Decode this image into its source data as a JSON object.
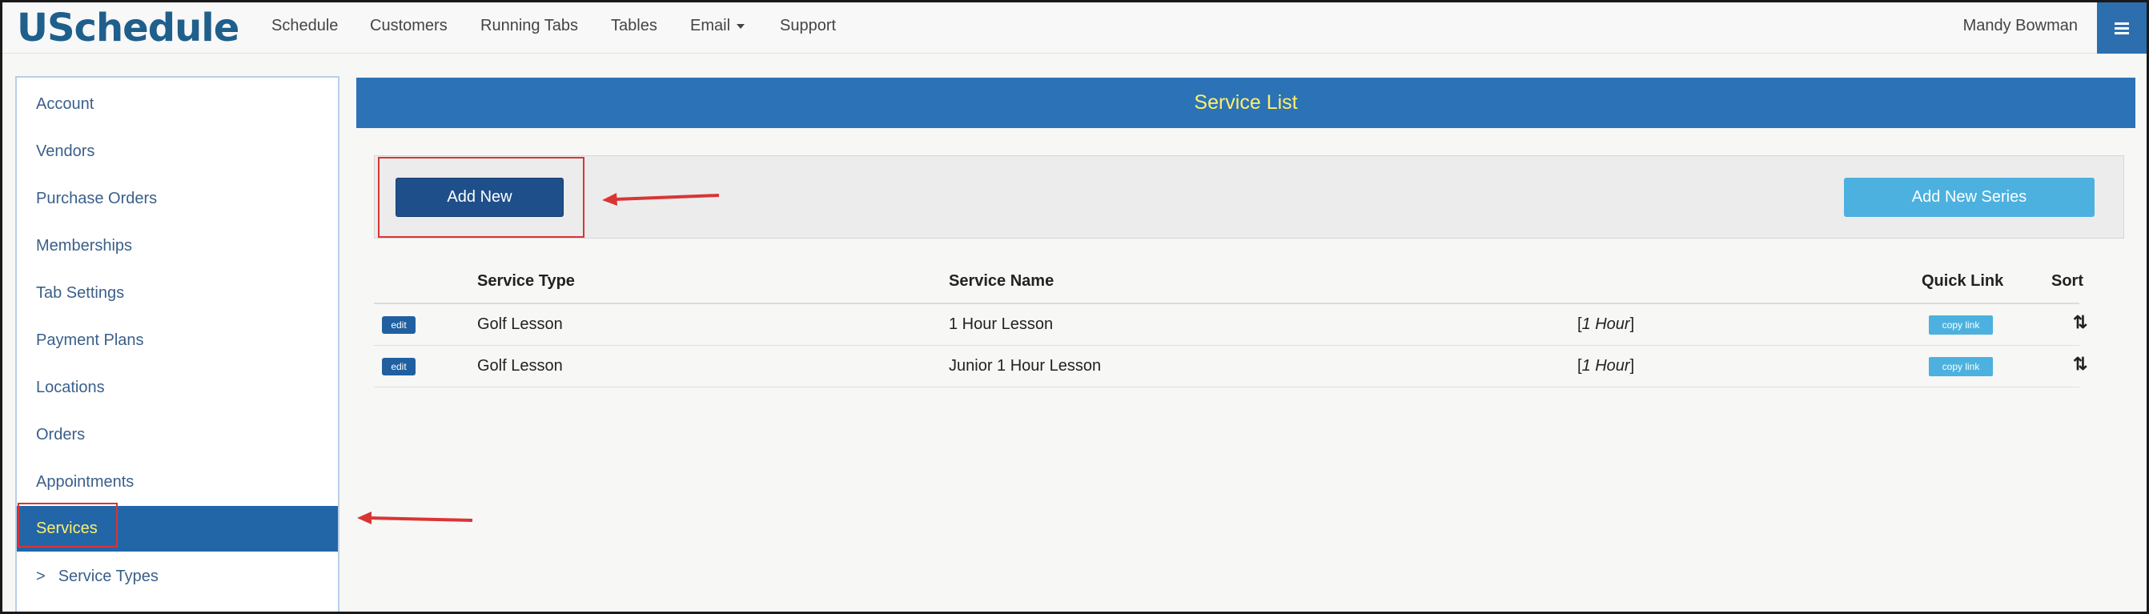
{
  "app": {
    "logo": "USchedule",
    "nav": [
      "Schedule",
      "Customers",
      "Running Tabs",
      "Tables",
      "Email",
      "Support"
    ],
    "user": "Mandy Bowman"
  },
  "sidebar": {
    "items": [
      {
        "label": "Account"
      },
      {
        "label": "Vendors"
      },
      {
        "label": "Purchase Orders"
      },
      {
        "label": "Memberships"
      },
      {
        "label": "Tab Settings"
      },
      {
        "label": "Payment Plans"
      },
      {
        "label": "Locations"
      },
      {
        "label": "Orders"
      },
      {
        "label": "Appointments"
      },
      {
        "label": "Services",
        "active": true
      }
    ],
    "sub_item": {
      "prefix": ">",
      "label": "Service Types"
    }
  },
  "main": {
    "title": "Service List",
    "add_new": "Add New",
    "add_new_series": "Add New Series",
    "table": {
      "headers": [
        "Service Type",
        "Service Name",
        "Quick Link",
        "Sort"
      ],
      "rows": [
        {
          "edit": "edit",
          "type": "Golf Lesson",
          "name": "1 Hour Lesson",
          "duration": "1 Hour",
          "link": "copy link"
        },
        {
          "edit": "edit",
          "type": "Golf Lesson",
          "name": "Junior 1 Hour Lesson",
          "duration": "1 Hour",
          "link": "copy link"
        }
      ]
    }
  },
  "icons": {
    "menu": "hamburger-menu-icon",
    "email_dropdown": "caret-down-icon",
    "sort": "sort-arrows-icon"
  },
  "colors": {
    "brand": "#1f5f8b",
    "header_bar": "#2c72b6",
    "active_text": "#ffef6b",
    "primary_button": "#1f4f8a",
    "info_button": "#4cb1de",
    "annotation": "#d93535"
  }
}
